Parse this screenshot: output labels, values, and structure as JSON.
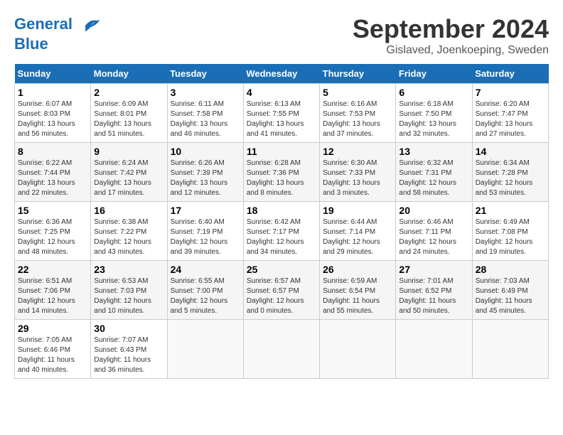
{
  "header": {
    "logo_line1": "General",
    "logo_line2": "Blue",
    "month_title": "September 2024",
    "location": "Gislaved, Joenkoeping, Sweden"
  },
  "days_of_week": [
    "Sunday",
    "Monday",
    "Tuesday",
    "Wednesday",
    "Thursday",
    "Friday",
    "Saturday"
  ],
  "weeks": [
    [
      {
        "day": "1",
        "sunrise": "6:07 AM",
        "sunset": "8:03 PM",
        "daylight": "13 hours and 56 minutes."
      },
      {
        "day": "2",
        "sunrise": "6:09 AM",
        "sunset": "8:01 PM",
        "daylight": "13 hours and 51 minutes."
      },
      {
        "day": "3",
        "sunrise": "6:11 AM",
        "sunset": "7:58 PM",
        "daylight": "13 hours and 46 minutes."
      },
      {
        "day": "4",
        "sunrise": "6:13 AM",
        "sunset": "7:55 PM",
        "daylight": "13 hours and 41 minutes."
      },
      {
        "day": "5",
        "sunrise": "6:16 AM",
        "sunset": "7:53 PM",
        "daylight": "13 hours and 37 minutes."
      },
      {
        "day": "6",
        "sunrise": "6:18 AM",
        "sunset": "7:50 PM",
        "daylight": "13 hours and 32 minutes."
      },
      {
        "day": "7",
        "sunrise": "6:20 AM",
        "sunset": "7:47 PM",
        "daylight": "13 hours and 27 minutes."
      }
    ],
    [
      {
        "day": "8",
        "sunrise": "6:22 AM",
        "sunset": "7:44 PM",
        "daylight": "13 hours and 22 minutes."
      },
      {
        "day": "9",
        "sunrise": "6:24 AM",
        "sunset": "7:42 PM",
        "daylight": "13 hours and 17 minutes."
      },
      {
        "day": "10",
        "sunrise": "6:26 AM",
        "sunset": "7:39 PM",
        "daylight": "13 hours and 12 minutes."
      },
      {
        "day": "11",
        "sunrise": "6:28 AM",
        "sunset": "7:36 PM",
        "daylight": "13 hours and 8 minutes."
      },
      {
        "day": "12",
        "sunrise": "6:30 AM",
        "sunset": "7:33 PM",
        "daylight": "13 hours and 3 minutes."
      },
      {
        "day": "13",
        "sunrise": "6:32 AM",
        "sunset": "7:31 PM",
        "daylight": "12 hours and 58 minutes."
      },
      {
        "day": "14",
        "sunrise": "6:34 AM",
        "sunset": "7:28 PM",
        "daylight": "12 hours and 53 minutes."
      }
    ],
    [
      {
        "day": "15",
        "sunrise": "6:36 AM",
        "sunset": "7:25 PM",
        "daylight": "12 hours and 48 minutes."
      },
      {
        "day": "16",
        "sunrise": "6:38 AM",
        "sunset": "7:22 PM",
        "daylight": "12 hours and 43 minutes."
      },
      {
        "day": "17",
        "sunrise": "6:40 AM",
        "sunset": "7:19 PM",
        "daylight": "12 hours and 39 minutes."
      },
      {
        "day": "18",
        "sunrise": "6:42 AM",
        "sunset": "7:17 PM",
        "daylight": "12 hours and 34 minutes."
      },
      {
        "day": "19",
        "sunrise": "6:44 AM",
        "sunset": "7:14 PM",
        "daylight": "12 hours and 29 minutes."
      },
      {
        "day": "20",
        "sunrise": "6:46 AM",
        "sunset": "7:11 PM",
        "daylight": "12 hours and 24 minutes."
      },
      {
        "day": "21",
        "sunrise": "6:49 AM",
        "sunset": "7:08 PM",
        "daylight": "12 hours and 19 minutes."
      }
    ],
    [
      {
        "day": "22",
        "sunrise": "6:51 AM",
        "sunset": "7:06 PM",
        "daylight": "12 hours and 14 minutes."
      },
      {
        "day": "23",
        "sunrise": "6:53 AM",
        "sunset": "7:03 PM",
        "daylight": "12 hours and 10 minutes."
      },
      {
        "day": "24",
        "sunrise": "6:55 AM",
        "sunset": "7:00 PM",
        "daylight": "12 hours and 5 minutes."
      },
      {
        "day": "25",
        "sunrise": "6:57 AM",
        "sunset": "6:57 PM",
        "daylight": "12 hours and 0 minutes."
      },
      {
        "day": "26",
        "sunrise": "6:59 AM",
        "sunset": "6:54 PM",
        "daylight": "11 hours and 55 minutes."
      },
      {
        "day": "27",
        "sunrise": "7:01 AM",
        "sunset": "6:52 PM",
        "daylight": "11 hours and 50 minutes."
      },
      {
        "day": "28",
        "sunrise": "7:03 AM",
        "sunset": "6:49 PM",
        "daylight": "11 hours and 45 minutes."
      }
    ],
    [
      {
        "day": "29",
        "sunrise": "7:05 AM",
        "sunset": "6:46 PM",
        "daylight": "11 hours and 40 minutes."
      },
      {
        "day": "30",
        "sunrise": "7:07 AM",
        "sunset": "6:43 PM",
        "daylight": "11 hours and 36 minutes."
      },
      null,
      null,
      null,
      null,
      null
    ]
  ]
}
